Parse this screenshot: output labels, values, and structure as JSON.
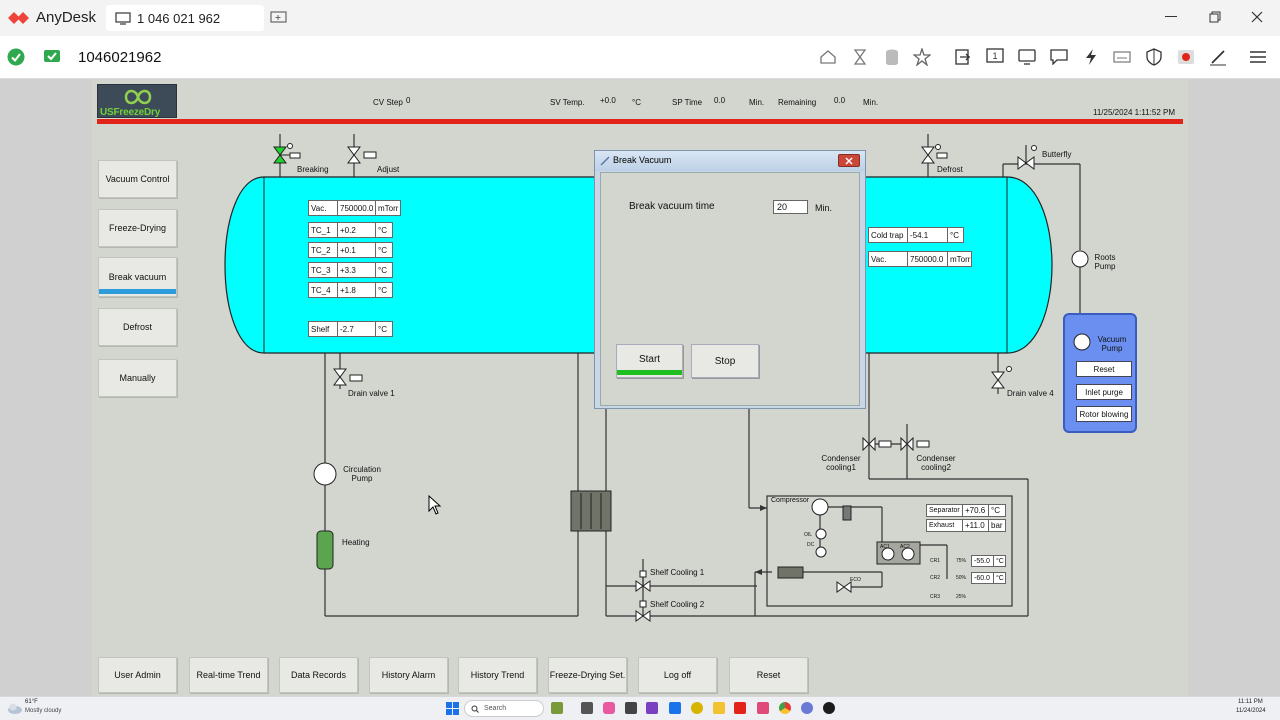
{
  "anydesk": {
    "app_name": "AnyDesk",
    "tab_title": "1 046 021 962",
    "address": "1046021962"
  },
  "hmi": {
    "logo": "USFreezeDry",
    "header": {
      "cv_step_label": "CV Step",
      "cv_step_value": "0",
      "sv_temp_label": "SV Temp.",
      "sv_temp_value": "+0.0",
      "sv_temp_unit": "°C",
      "sp_time_label": "SP Time",
      "sp_time_value": "0.0",
      "sp_time_unit": "Min.",
      "remaining_label": "Remaining",
      "remaining_value": "0.0",
      "remaining_unit": "Min.",
      "datetime": "11/25/2024 1:11:52 PM"
    },
    "nav": [
      "Vacuum Control",
      "Freeze-Drying",
      "Break vacuum",
      "Defrost",
      "Manually"
    ],
    "chamber": {
      "vac_label": "Vac.",
      "vac_value": "750000.0",
      "vac_unit": "mTorr",
      "tc": [
        {
          "label": "TC_1",
          "value": "+0.2",
          "unit": "°C"
        },
        {
          "label": "TC_2",
          "value": "+0.1",
          "unit": "°C"
        },
        {
          "label": "TC_3",
          "value": "+3.3",
          "unit": "°C"
        },
        {
          "label": "TC_4",
          "value": "+1.8",
          "unit": "°C"
        }
      ],
      "shelf_label": "Shelf",
      "shelf_value": "-2.7",
      "shelf_unit": "°C"
    },
    "condenser": {
      "cold_trap_label": "Cold trap",
      "cold_trap_value": "-54.1",
      "cold_trap_unit": "°C",
      "vac_label": "Vac.",
      "vac_value": "750000.0",
      "vac_unit": "mTorr"
    },
    "valves": {
      "breaking": "Breaking",
      "adjust": "Adjust",
      "defrost": "Defrost",
      "butterfly": "Butterfly",
      "drain1": "Drain valve 1",
      "drain4": "Drain valve 4",
      "cond1": "Condenser cooling1",
      "cond2": "Condenser cooling2",
      "shelf1": "Shelf Cooling 1",
      "shelf2": "Shelf Cooling 2"
    },
    "pumps": {
      "roots": "Roots Pump",
      "circulation": "Circulation Pump",
      "heating": "Heating",
      "vacuum": "Vacuum Pump"
    },
    "vacuum_pump_buttons": [
      "Reset",
      "Inlet purge",
      "Rotor blowing"
    ],
    "compressor": {
      "title": "Compressor",
      "separator_label": "Separator",
      "separator_value": "+70.6",
      "separator_unit": "°C",
      "exhaust_label": "Exhaust",
      "exhaust_value": "+11.0",
      "exhaust_unit": "bar",
      "cr1": "CR1",
      "cr1_pct": "75%",
      "cr1_value": "-55.0",
      "cr1_unit": "°C",
      "cr2": "CR2",
      "cr2_pct": "50%",
      "cr2_value": "-60.0",
      "cr2_unit": "°C",
      "cr3": "CR3",
      "cr3_pct": "25%",
      "oil": "OIL",
      "dc": "DC",
      "ac1": "AC1",
      "ac2": "AC2",
      "eco": "ECO"
    },
    "dialog": {
      "title": "Break Vacuum",
      "time_label": "Break vacuum time",
      "time_value": "20",
      "time_unit": "Min.",
      "start": "Start",
      "stop": "Stop"
    },
    "bottom": [
      "User Admin",
      "Real-time Trend",
      "Data Records",
      "History Alarm",
      "History Trend",
      "Freeze-Drying Set.",
      "Log off",
      "Reset"
    ]
  },
  "taskbar": {
    "weather_temp": "61°F",
    "weather_text": "Mostly cloudy",
    "search": "Search",
    "time": "11:11 PM",
    "date": "11/24/2024"
  },
  "colors": {
    "accent_red": "#e2231a",
    "chamber_cyan": "#00ffff",
    "vacuum_pump_blue": "#6b8ff0",
    "hmi_background": "#d3d5cf",
    "active_indicator": "#2d9cdb",
    "start_indicator": "#1fbf1f"
  }
}
